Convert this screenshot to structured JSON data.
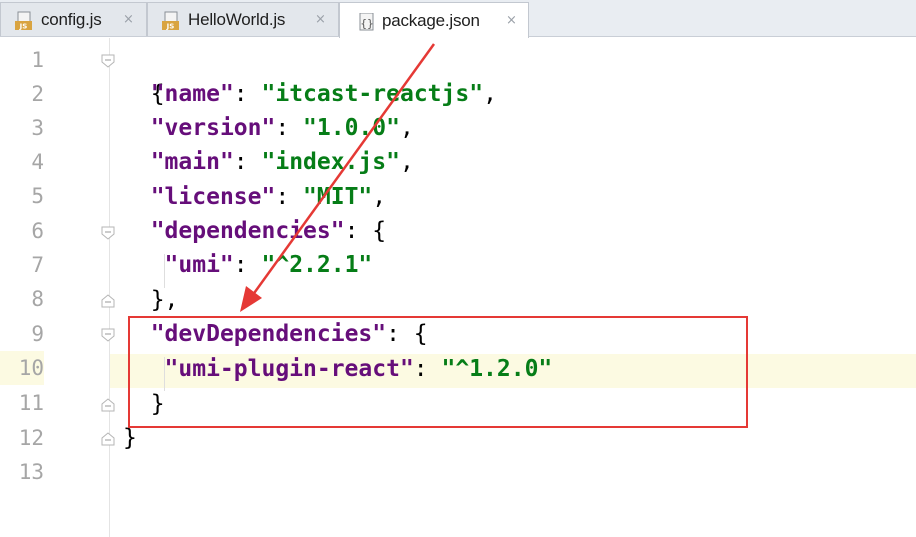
{
  "tabs": [
    {
      "label": "config.js",
      "icon": "js-file-icon",
      "active": false
    },
    {
      "label": "HelloWorld.js",
      "icon": "js-file-icon",
      "active": false
    },
    {
      "label": "package.json",
      "icon": "json-file-icon",
      "active": true
    }
  ],
  "tab_close_glyph": "×",
  "js_icon_text": "JS",
  "line_numbers": [
    "1",
    "2",
    "3",
    "4",
    "5",
    "6",
    "7",
    "8",
    "9",
    "10",
    "11",
    "12",
    "13"
  ],
  "current_line": "10",
  "code": {
    "l1": {
      "p1": "{"
    },
    "l2": {
      "k": "\"name\"",
      "p1": ": ",
      "s": "\"itcast-reactjs\"",
      "p2": ","
    },
    "l3": {
      "k": "\"version\"",
      "p1": ": ",
      "s": "\"1.0.0\"",
      "p2": ","
    },
    "l4": {
      "k": "\"main\"",
      "p1": ": ",
      "s": "\"index.js\"",
      "p2": ","
    },
    "l5": {
      "k": "\"license\"",
      "p1": ": ",
      "s": "\"MIT\"",
      "p2": ","
    },
    "l6": {
      "k": "\"dependencies\"",
      "p1": ": {"
    },
    "l7": {
      "k": "\"umi\"",
      "p1": ": ",
      "s": "\"^2.2.1\""
    },
    "l8": {
      "p1": "},"
    },
    "l9": {
      "k": "\"devDependencies\"",
      "p1": ": {"
    },
    "l10": {
      "k": "\"umi-plugin-react\"",
      "p1": ": ",
      "s": "\"^1.2.0\""
    },
    "l11": {
      "p1": "}"
    },
    "l12": {
      "p1": "}"
    }
  },
  "colors": {
    "key": "#660e7a",
    "string": "#067d17",
    "annotation": "#e53935",
    "current_line_bg": "#fcfae2"
  }
}
